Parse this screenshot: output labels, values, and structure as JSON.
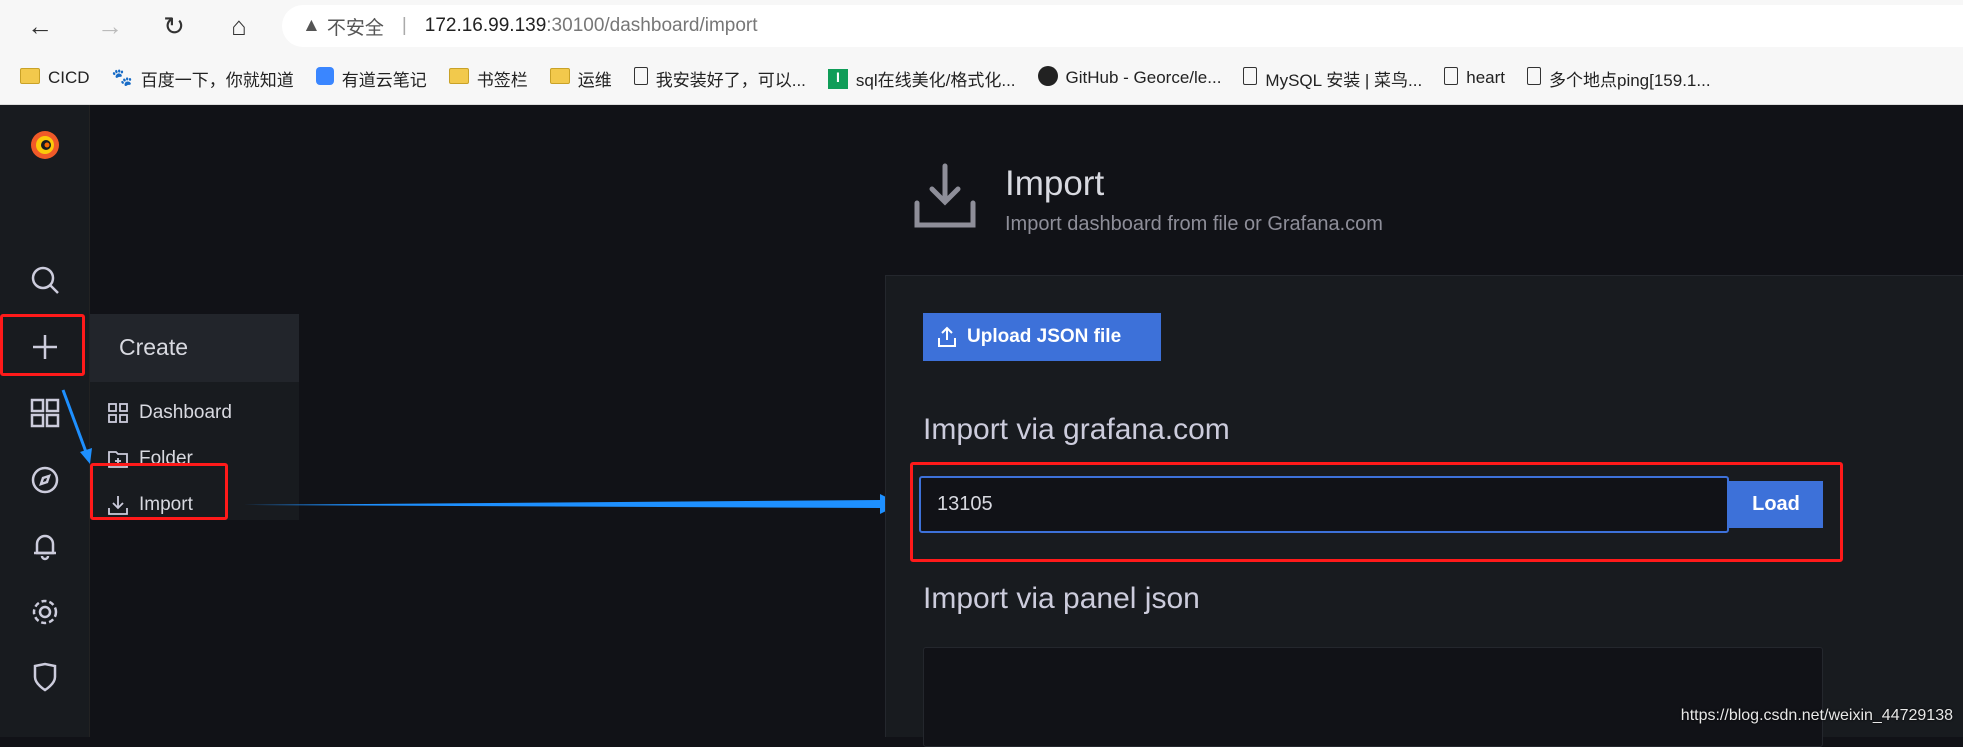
{
  "browser": {
    "security_label": "不安全",
    "url_host": "172.16.99.139",
    "url_rest": ":30100/dashboard/import",
    "bookmarks": [
      {
        "icon": "folder-icon",
        "label": "CICD"
      },
      {
        "icon": "baidu-icon",
        "label": "百度一下，你就知道"
      },
      {
        "icon": "youdao-icon",
        "label": "有道云笔记"
      },
      {
        "icon": "folder-icon",
        "label": "书签栏"
      },
      {
        "icon": "folder-icon",
        "label": "运维"
      },
      {
        "icon": "page-icon",
        "label": "我安装好了，可以..."
      },
      {
        "icon": "sql-icon",
        "label": "sql在线美化/格式化..."
      },
      {
        "icon": "github-icon",
        "label": "GitHub - Georce/le..."
      },
      {
        "icon": "page-icon",
        "label": "MySQL 安装 | 菜鸟..."
      },
      {
        "icon": "page-icon",
        "label": "heart"
      },
      {
        "icon": "page-icon",
        "label": "多个地点ping[159.1..."
      }
    ]
  },
  "menu": {
    "title": "Create",
    "items": [
      {
        "icon": "dashboard-icon",
        "label": "Dashboard"
      },
      {
        "icon": "folder-plus-icon",
        "label": "Folder"
      },
      {
        "icon": "import-icon",
        "label": "Import"
      }
    ]
  },
  "header": {
    "title": "Import",
    "subtitle": "Import dashboard from file or Grafana.com"
  },
  "main": {
    "upload_label": "Upload JSON file",
    "grafana_heading": "Import via grafana.com",
    "grafana_input_value": "13105",
    "load_label": "Load",
    "panel_json_heading": "Import via panel json"
  },
  "watermark": "https://blog.csdn.net/weixin_44729138",
  "colors": {
    "accent": "#3d71d9",
    "annotation_red": "#ff1a1a",
    "annotation_arrow": "#1e90ff"
  }
}
